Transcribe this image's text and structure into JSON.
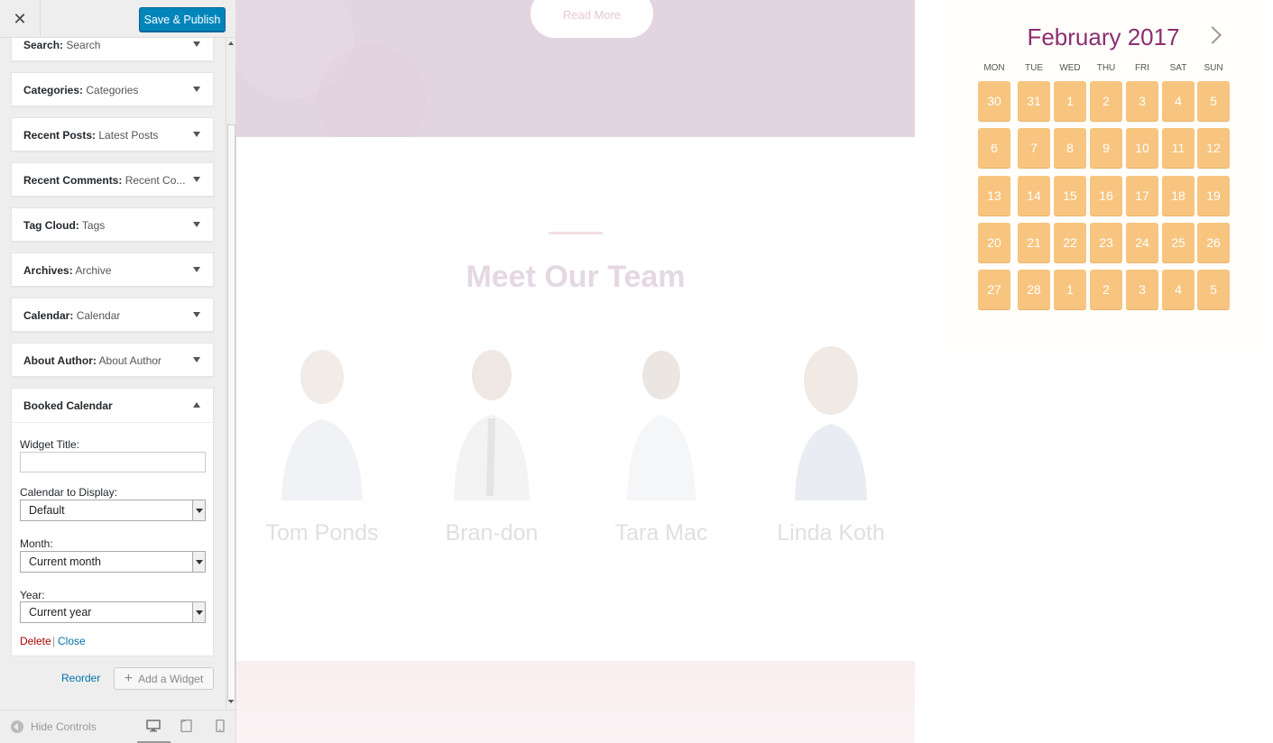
{
  "header": {
    "close_label": "✕",
    "publish_label": "Save & Publish"
  },
  "widgets": [
    {
      "type": "Search:",
      "title": "Search"
    },
    {
      "type": "Categories:",
      "title": "Categories"
    },
    {
      "type": "Recent Posts:",
      "title": "Latest Posts"
    },
    {
      "type": "Recent Comments:",
      "title": "Recent Co..."
    },
    {
      "type": "Tag Cloud:",
      "title": "Tags"
    },
    {
      "type": "Archives:",
      "title": "Archive"
    },
    {
      "type": "Calendar:",
      "title": "Calendar"
    },
    {
      "type": "About Author:",
      "title": "About Author"
    }
  ],
  "booked": {
    "heading": "Booked Calendar",
    "widget_title_label": "Widget Title:",
    "widget_title_value": "",
    "calendar_label": "Calendar to Display:",
    "calendar_value": "Default",
    "month_label": "Month:",
    "month_value": "Current month",
    "year_label": "Year:",
    "year_value": "Current year",
    "delete_label": "Delete",
    "separator": "|",
    "close_label": "Close"
  },
  "footer": {
    "reorder_label": "Reorder",
    "add_widget_label": "Add a Widget",
    "hide_controls_label": "Hide Controls"
  },
  "preview": {
    "read_more_label": "Read More",
    "team_title": "Meet Our Team",
    "members": [
      {
        "name": "Tom Ponds"
      },
      {
        "name": "Bran-don"
      },
      {
        "name": "Tara Mac"
      },
      {
        "name": "Linda Koth"
      }
    ]
  },
  "calendar": {
    "title": "February 2017",
    "weekdays": [
      "MON",
      "TUE",
      "WED",
      "THU",
      "FRI",
      "SAT",
      "SUN"
    ],
    "weeks": [
      [
        "30",
        "31",
        "1",
        "2",
        "3",
        "4",
        "5"
      ],
      [
        "6",
        "7",
        "8",
        "9",
        "10",
        "11",
        "12"
      ],
      [
        "13",
        "14",
        "15",
        "16",
        "17",
        "18",
        "19"
      ],
      [
        "20",
        "21",
        "22",
        "23",
        "24",
        "25",
        "26"
      ],
      [
        "27",
        "28",
        "1",
        "2",
        "3",
        "4",
        "5"
      ]
    ],
    "colors": {
      "day_bg": "#f7c57f",
      "title": "#8b2f6e"
    }
  }
}
